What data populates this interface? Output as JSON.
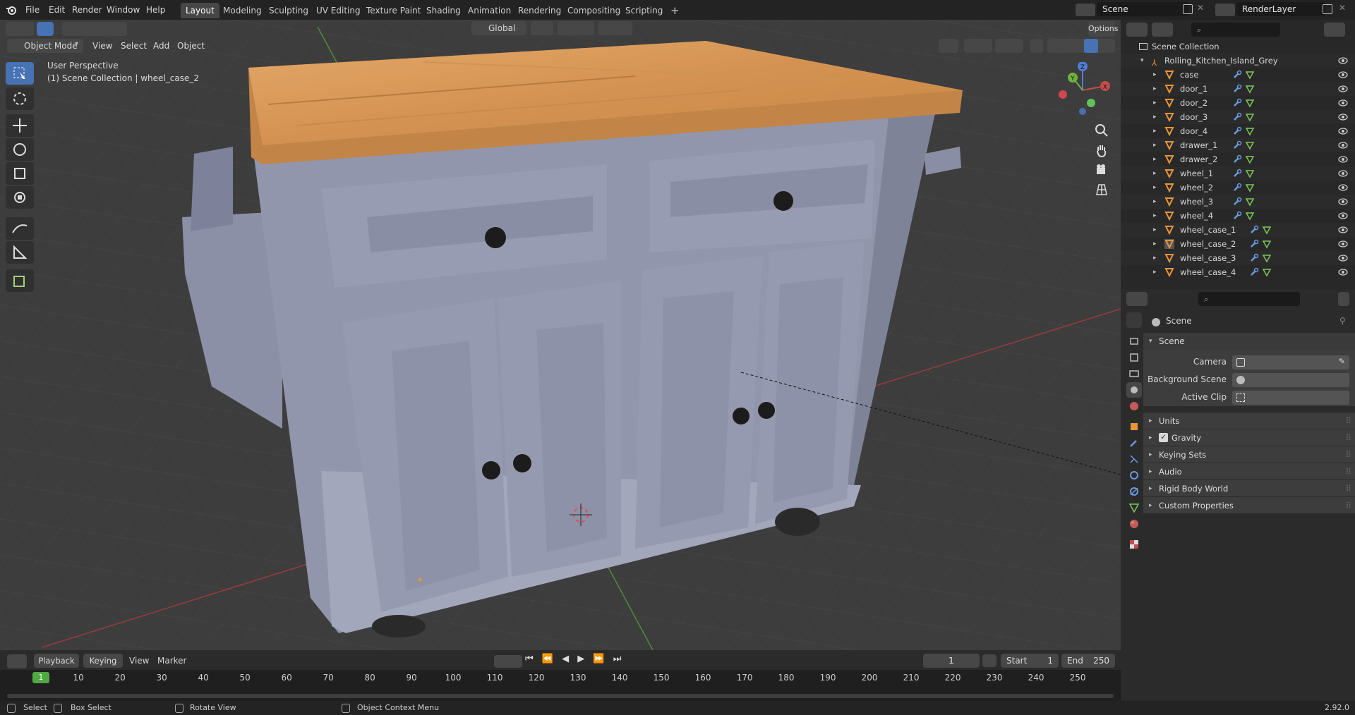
{
  "app": {
    "menus": [
      "File",
      "Edit",
      "Render",
      "Window",
      "Help"
    ],
    "workspace_tabs": [
      "Layout",
      "Modeling",
      "Sculpting",
      "UV Editing",
      "Texture Paint",
      "Shading",
      "Animation",
      "Rendering",
      "Compositing",
      "Scripting"
    ],
    "active_tab": "Layout",
    "add_tab": "+",
    "scene_name": "Scene",
    "view_layer": "RenderLayer"
  },
  "viewport": {
    "mode": "Object Mode",
    "menus": [
      "View",
      "Select",
      "Add",
      "Object"
    ],
    "transform_orientation": "Global",
    "options_label": "Options",
    "perspective_label": "User Perspective",
    "collection_label": "(1) Scene Collection | wheel_case_2",
    "gizmo_axes": [
      "X",
      "Y",
      "Z"
    ],
    "tools": [
      "select-box",
      "cursor",
      "move",
      "rotate",
      "scale",
      "transform",
      "annotate",
      "measure",
      "add-cube"
    ]
  },
  "timeline": {
    "menus": [
      "Playback",
      "Keying",
      "View",
      "Marker"
    ],
    "current_frame": "1",
    "start_label": "Start",
    "start": "1",
    "end_label": "End",
    "end": "250",
    "ruler": [
      "1",
      "10",
      "20",
      "30",
      "40",
      "50",
      "60",
      "70",
      "80",
      "90",
      "100",
      "110",
      "120",
      "130",
      "140",
      "150",
      "160",
      "170",
      "180",
      "190",
      "200",
      "210",
      "220",
      "230",
      "240",
      "250"
    ]
  },
  "statusbar": {
    "select": "Select",
    "box_select": "Box Select",
    "rotate_view": "Rotate View",
    "context_menu": "Object Context Menu",
    "version": "2.92.0"
  },
  "outliner": {
    "root": "Scene Collection",
    "collection": "Rolling_Kitchen_Island_Grey",
    "objects": [
      "case",
      "door_1",
      "door_2",
      "door_3",
      "door_4",
      "drawer_1",
      "drawer_2",
      "wheel_1",
      "wheel_2",
      "wheel_3",
      "wheel_4",
      "wheel_case_1",
      "wheel_case_2",
      "wheel_case_3",
      "wheel_case_4"
    ],
    "selected": "wheel_case_2"
  },
  "properties": {
    "title": "Scene",
    "panel": "Scene",
    "camera_label": "Camera",
    "background_scene_label": "Background Scene",
    "active_clip_label": "Active Clip",
    "subpanels": [
      "Units",
      "Gravity",
      "Keying Sets",
      "Audio",
      "Rigid Body World",
      "Custom Properties"
    ],
    "gravity_checked": true
  },
  "colors": {
    "accent": "#4772b3",
    "object_orange": "#e8953a",
    "axis_x": "#c44d4d",
    "axis_y": "#6db33d",
    "axis_z": "#4f7ed6"
  }
}
